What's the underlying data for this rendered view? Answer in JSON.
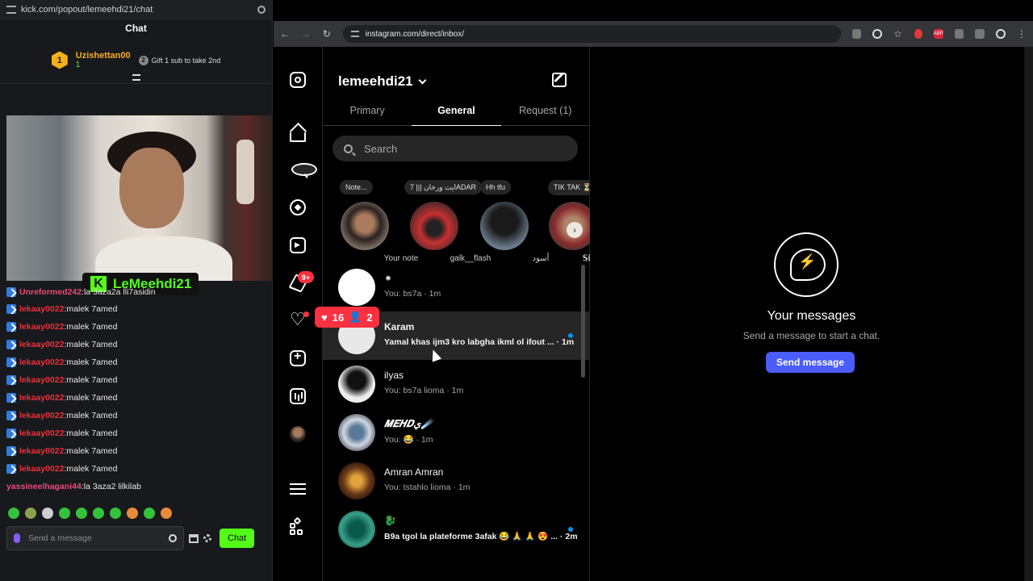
{
  "kick": {
    "url": "kick.com/popout/lemeehdi21/chat",
    "header": "Chat",
    "leader": {
      "rank": "1",
      "name": "Uzishettan00",
      "subs": "1",
      "gift_text": "Gift 1 sub to take 2nd",
      "gift_rank": "2"
    },
    "streamer_name": "LeMeehdi21",
    "messages": [
      {
        "user": "Unreformed242",
        "text": "la 3aza2a lli7asidin",
        "color": "pink"
      },
      {
        "user": "lekaay0022",
        "text": "malek 7amed",
        "color": "red"
      },
      {
        "user": "lekaay0022",
        "text": "malek 7amed",
        "color": "red"
      },
      {
        "user": "lekaay0022",
        "text": "malek 7amed",
        "color": "red"
      },
      {
        "user": "lekaay0022",
        "text": "malek 7amed",
        "color": "red"
      },
      {
        "user": "lekaay0022",
        "text": "malek 7amed",
        "color": "red"
      },
      {
        "user": "lekaay0022",
        "text": "malek 7amed",
        "color": "red"
      },
      {
        "user": "lekaay0022",
        "text": "malek 7amed",
        "color": "red"
      },
      {
        "user": "lekaay0022",
        "text": "malek 7amed",
        "color": "red"
      },
      {
        "user": "lekaay0022",
        "text": "malek 7amed",
        "color": "red"
      },
      {
        "user": "lekaay0022",
        "text": "malek 7amed",
        "color": "red"
      },
      {
        "user": "yassineelhagani44",
        "text": "la 3aza2 lilkilab",
        "color": "pink"
      }
    ],
    "input_placeholder": "Send a message",
    "send_label": "Chat",
    "accent": "#53fc18"
  },
  "browser": {
    "url": "instagram.com/direct/inbox/"
  },
  "instagram": {
    "account": "lemeehdi21",
    "tabs": [
      "Primary",
      "General",
      "Request (1)"
    ],
    "active_tab": "General",
    "search_placeholder": "Search",
    "dm_badge": "9+",
    "live_overlay": {
      "likes": "16",
      "viewers": "2"
    },
    "notes": [
      {
        "bubble": "Note...",
        "name": "Your note"
      },
      {
        "bubble": "ايت ورخان ||| 7ADAR",
        "name": "galk__flash"
      },
      {
        "bubble": "Hh tfu",
        "name": "أسود"
      },
      {
        "bubble": "TIK TAK ⏳",
        "name": "𝕊𝕚𝕞𝕠𝕙𝕒𝕞𝕖𝕕"
      }
    ],
    "threads": [
      {
        "name": "⁕",
        "preview": "You: bs7a · 1m",
        "unread": false
      },
      {
        "name": "Karam",
        "preview": "Yamal khas ijm3 kro labgha ikml ol ifout ... · 1m",
        "unread": true
      },
      {
        "name": "ilyas",
        "preview": "You: bs7a lioma · 1m",
        "unread": false
      },
      {
        "name": "𝑴𝑬𝑯𝑫ي☄️",
        "preview": "You: 😂 · 1m",
        "unread": false
      },
      {
        "name": "Amran Amran",
        "preview": "You: tstahlo lioma · 1m",
        "unread": false
      },
      {
        "name": "🐉",
        "preview": "B9a tgol la plateforme 3afak 😂 🙏 🙏 😍 ... · 2m",
        "unread": true
      }
    ],
    "empty_title": "Your messages",
    "empty_sub": "Send a message to start a chat.",
    "send_button": "Send message",
    "accent": "#4a5df9"
  }
}
